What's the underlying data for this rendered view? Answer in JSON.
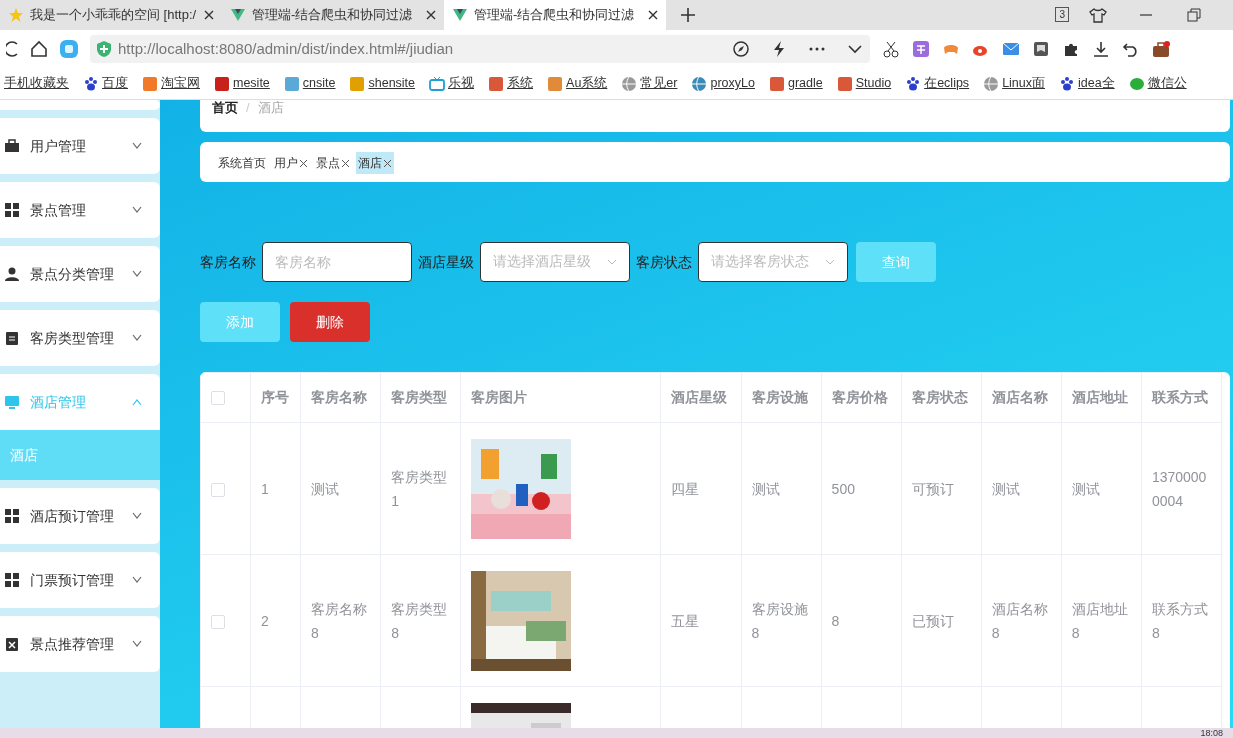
{
  "browser": {
    "tabs": [
      {
        "title": "我是一个小乖乖的空间 [http:/",
        "kind": "star",
        "selected": false
      },
      {
        "title": "管理端-结合爬虫和协同过滤",
        "kind": "vue",
        "selected": false
      },
      {
        "title": "管理端-结合爬虫和协同过滤",
        "kind": "vue",
        "selected": true
      }
    ],
    "tab_count": "3",
    "url": "http://localhost:8080/admin/dist/index.html#/jiudian",
    "bookmarks": [
      {
        "label": "手机收藏夹"
      },
      {
        "label": "百度",
        "kind": "paw",
        "color": "#2b3fcf"
      },
      {
        "label": "淘宝网",
        "kind": "square",
        "color": "#f07a2a"
      },
      {
        "label": "mesite",
        "kind": "square",
        "color": "#c8201a"
      },
      {
        "label": "cnsite",
        "kind": "square",
        "color": "#5aaad8"
      },
      {
        "label": "shensite",
        "kind": "square",
        "color": "#e0a000"
      },
      {
        "label": "乐视",
        "kind": "tv",
        "color": "#20a0d0"
      },
      {
        "label": "系统",
        "kind": "square",
        "color": "#d9583a"
      },
      {
        "label": "Au系统",
        "kind": "square",
        "color": "#e08a3a"
      },
      {
        "label": "常见er",
        "kind": "globe",
        "color": "#999999"
      },
      {
        "label": "proxyLo",
        "kind": "globe",
        "color": "#3a8ab8"
      },
      {
        "label": "gradle",
        "kind": "square",
        "color": "#d9583a"
      },
      {
        "label": "Studio",
        "kind": "square",
        "color": "#d9583a"
      },
      {
        "label": "在eclips",
        "kind": "paw",
        "color": "#2b3fcf"
      },
      {
        "label": "Linux面",
        "kind": "globe",
        "color": "#999999"
      },
      {
        "label": "idea全",
        "kind": "paw",
        "color": "#2b3fcf"
      },
      {
        "label": "微信公",
        "kind": "chat",
        "color": "#2aae3a"
      }
    ]
  },
  "sidebar": {
    "items": [
      {
        "label": "用户管理",
        "kind": "briefcase",
        "expanded": false
      },
      {
        "label": "景点管理",
        "kind": "grid",
        "expanded": false
      },
      {
        "label": "景点分类管理",
        "kind": "person",
        "expanded": false
      },
      {
        "label": "客房类型管理",
        "kind": "clipboard",
        "expanded": false
      },
      {
        "label": "酒店管理",
        "kind": "monitor",
        "expanded": true,
        "children": [
          {
            "label": "酒店",
            "selected": true
          }
        ]
      },
      {
        "label": "酒店预订管理",
        "kind": "grid",
        "expanded": false
      },
      {
        "label": "门票预订管理",
        "kind": "grid",
        "expanded": false
      },
      {
        "label": "景点推荐管理",
        "kind": "xclip",
        "expanded": false
      }
    ]
  },
  "breadcrumb": {
    "items": [
      "首页",
      "酒店"
    ],
    "separator": "/"
  },
  "open_tabs": [
    {
      "label": "系统首页",
      "closable": false,
      "selected": false
    },
    {
      "label": "用户",
      "closable": true,
      "selected": false
    },
    {
      "label": "景点",
      "closable": true,
      "selected": false
    },
    {
      "label": "酒店",
      "closable": true,
      "selected": true
    }
  ],
  "filters": [
    {
      "label": "客房名称",
      "kind": "input",
      "placeholder": "客房名称"
    },
    {
      "label": "酒店星级",
      "kind": "select",
      "placeholder": "请选择酒店星级"
    },
    {
      "label": "客房状态",
      "kind": "select",
      "placeholder": "请选择客房状态"
    }
  ],
  "search_button": "查询",
  "actions": [
    {
      "label": "添加",
      "kind": "add"
    },
    {
      "label": "删除",
      "kind": "delete"
    }
  ],
  "table": {
    "all_checked": false,
    "columns": [
      "序号",
      "客房名称",
      "客房类型",
      "客房图片",
      "酒店星级",
      "客房设施",
      "客房价格",
      "客房状态",
      "酒店名称",
      "酒店地址",
      "联系方式"
    ],
    "rows": [
      {
        "checked": false,
        "cells": [
          "1",
          "测试",
          "客房类型1",
          null,
          "四星",
          "测试",
          "500",
          "可预订",
          "测试",
          "测试",
          "13700000004"
        ],
        "image": {
          "kind": "picture"
        }
      },
      {
        "checked": false,
        "cells": [
          "2",
          "客房名称8",
          "客房类型8",
          null,
          "五星",
          "客房设施8",
          "8",
          "已预订",
          "酒店名称8",
          "酒店地址8",
          "联系方式8"
        ],
        "image": {
          "kind": "picture"
        }
      },
      {
        "image": {
          "kind": "picture"
        }
      }
    ]
  },
  "taskbar": {
    "clock": "18:08"
  }
}
